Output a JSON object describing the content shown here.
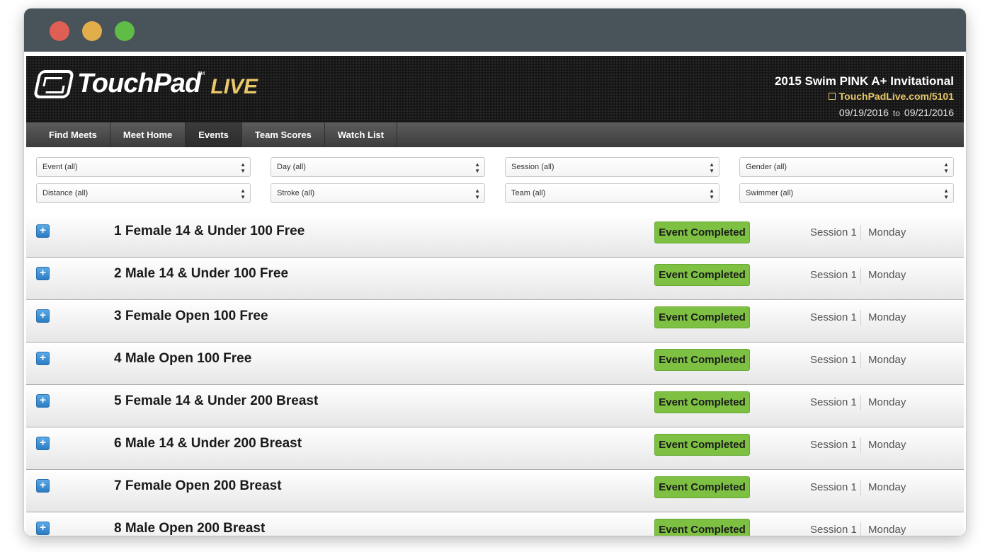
{
  "window": {
    "controls": [
      "close",
      "minimize",
      "zoom"
    ]
  },
  "logo": {
    "main": "TouchPad",
    "live": "LIVE",
    "tm": "TM"
  },
  "meet": {
    "name": "2015 Swim PINK A+ Invitational",
    "link": "TouchPadLive.com/5101",
    "start_date": "09/19/2016",
    "to_label": "to",
    "end_date": "09/21/2016"
  },
  "nav": {
    "items": [
      {
        "label": "Find Meets"
      },
      {
        "label": "Meet Home"
      },
      {
        "label": "Events",
        "active": true
      },
      {
        "label": "Team Scores"
      },
      {
        "label": "Watch List"
      }
    ]
  },
  "filters": {
    "row1": [
      "Event (all)",
      "Day (all)",
      "Session (all)",
      "Gender (all)"
    ],
    "row2": [
      "Distance (all)",
      "Stroke (all)",
      "Team (all)",
      "Swimmer (all)"
    ]
  },
  "events": [
    {
      "title": "1 Female 14 & Under 100 Free",
      "status": "Event Completed",
      "session": "Session 1",
      "day": "Monday"
    },
    {
      "title": "2 Male 14 & Under 100 Free",
      "status": "Event Completed",
      "session": "Session 1",
      "day": "Monday"
    },
    {
      "title": "3 Female Open 100 Free",
      "status": "Event Completed",
      "session": "Session 1",
      "day": "Monday"
    },
    {
      "title": "4 Male Open 100 Free",
      "status": "Event Completed",
      "session": "Session 1",
      "day": "Monday"
    },
    {
      "title": "5 Female 14 & Under 200 Breast",
      "status": "Event Completed",
      "session": "Session 1",
      "day": "Monday"
    },
    {
      "title": "6 Male 14 & Under 200 Breast",
      "status": "Event Completed",
      "session": "Session 1",
      "day": "Monday"
    },
    {
      "title": "7 Female Open 200 Breast",
      "status": "Event Completed",
      "session": "Session 1",
      "day": "Monday"
    },
    {
      "title": "8 Male Open 200 Breast",
      "status": "Event Completed",
      "session": "Session 1",
      "day": "Monday"
    }
  ],
  "colors": {
    "status_green": "#7dc042",
    "accent_gold": "#e9c86a",
    "expand_blue": "#3a8fd6"
  }
}
